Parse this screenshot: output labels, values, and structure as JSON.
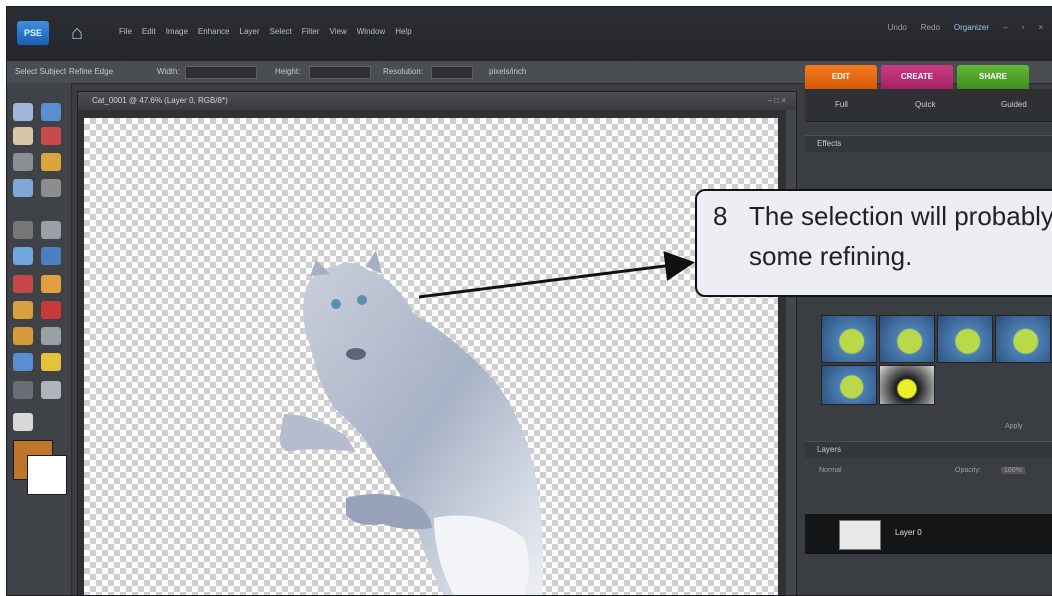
{
  "app": {
    "logo_text": "PSE",
    "menus": [
      "File",
      "Edit",
      "Image",
      "Enhance",
      "Layer",
      "Select",
      "Filter",
      "View",
      "Window",
      "Help"
    ],
    "right_tools": [
      "Undo",
      "Redo",
      "Organizer"
    ],
    "window_controls": [
      "–",
      "▫",
      "×"
    ]
  },
  "options_bar": {
    "items": [
      "Select Subject",
      "Refine Edge",
      "Width:",
      "Height:",
      "Resolution:",
      "pixels/inch"
    ]
  },
  "tabs": [
    {
      "label": "EDIT"
    },
    {
      "label": "CREATE"
    },
    {
      "label": "SHARE"
    }
  ],
  "document": {
    "title": "Cat_0001 @ 47.6% (Layer 0, RGB/8*)",
    "controls": "– □ ×"
  },
  "panel": {
    "top_tabs": [
      "Full",
      "Quick",
      "Guided"
    ],
    "effects_header": "Effects",
    "layers_header": "Layers",
    "blend_mode": "Normal",
    "opacity_label": "Opacity:",
    "opacity_value": "100%",
    "layer_name": "Layer 0",
    "apply_label": "Apply"
  },
  "callout": {
    "number": "8",
    "line1": "The selection will probably need",
    "line2": "some refining."
  },
  "colors": {
    "foreground": "#c0742c",
    "background": "#ffffff",
    "accent_edit": "#f47b1f",
    "accent_create": "#cc3c84",
    "accent_share": "#63b83a"
  },
  "icons": [
    "home-icon",
    "move-icon",
    "zoom-icon",
    "hand-icon",
    "eyedropper-icon",
    "marquee-icon",
    "lasso-icon",
    "magic-wand-icon",
    "quick-selection-icon",
    "type-icon",
    "crop-icon",
    "cookie-cutter-icon",
    "straighten-icon",
    "red-eye-icon",
    "healing-brush-icon",
    "clone-stamp-icon",
    "eraser-icon",
    "brush-icon",
    "paint-bucket-icon",
    "gradient-icon",
    "shape-icon",
    "blur-icon",
    "sponge-icon",
    "camera-icon"
  ]
}
